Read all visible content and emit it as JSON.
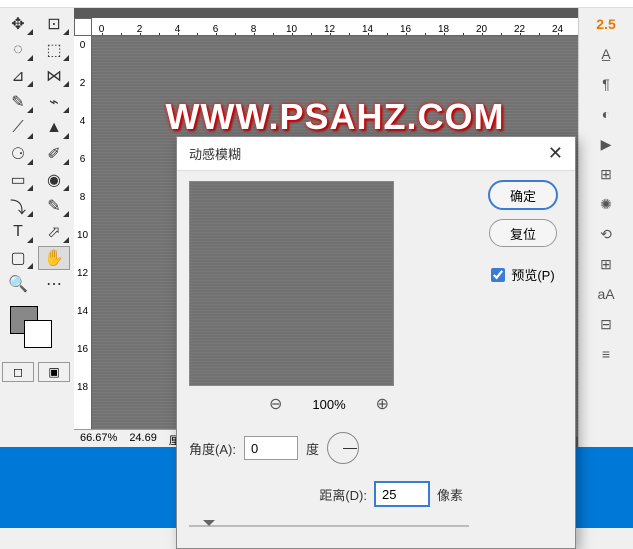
{
  "ruler_h": [
    "0",
    "",
    "2",
    "",
    "4",
    "",
    "6",
    "",
    "8",
    "",
    "10",
    "",
    "12",
    "",
    "14",
    "",
    "16",
    "",
    "18",
    "",
    "20",
    "",
    "22",
    "",
    "24"
  ],
  "ruler_v": [
    "0",
    "",
    "2",
    "",
    "4",
    "",
    "6",
    "",
    "8",
    "",
    "10",
    "",
    "12",
    "",
    "14",
    "",
    "16",
    "",
    "18"
  ],
  "watermark": "WWW.PSAHZ.COM",
  "status": {
    "zoom": "66.67%",
    "pos": "24.69",
    "unit": "厘"
  },
  "version": "2.5",
  "dialog": {
    "title": "动感模糊",
    "zoom": "100%",
    "ok": "确定",
    "reset": "复位",
    "preview": "预览(P)",
    "angle_label": "角度(A):",
    "angle_value": "0",
    "angle_unit": "度",
    "distance_label": "距离(D):",
    "distance_value": "25",
    "distance_unit": "像素"
  },
  "tool_glyphs": [
    "✥",
    "⊡",
    "◌",
    "⬚",
    "⊿",
    "⋈",
    "✎",
    "⌁",
    "⟋",
    "▲",
    "⚆",
    "✐",
    "▭",
    "◉",
    "⤵",
    "✎",
    "T",
    "⬀",
    "▢",
    "✋",
    "🔍",
    "⋯"
  ],
  "rp_glyphs": [
    "A̲",
    "¶",
    "◐",
    "▶",
    "⊞",
    "✺",
    "⟲",
    "⊞",
    "aA",
    "⊟",
    "≡"
  ]
}
